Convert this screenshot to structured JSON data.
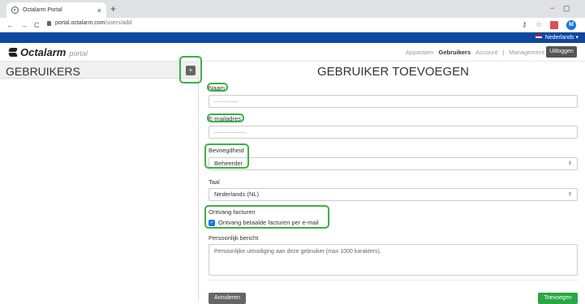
{
  "browser": {
    "tab_title": "Octalarm Portal",
    "tab_close": "×",
    "new_tab": "+",
    "url_host": "portal.octalarm.com",
    "url_path": "/users/add",
    "minimize": "−",
    "maximize": "▢",
    "avatar_letter": "M"
  },
  "langbar": {
    "language": "Nederlands ▾"
  },
  "nav": {
    "brand": "Octalarm",
    "brand_sub": "portal",
    "items": [
      "Apparaten",
      "Gebruikers",
      "Account",
      "|",
      "Management"
    ],
    "active_index": 1,
    "logout": "Uitloggen"
  },
  "left": {
    "title": "GEBRUIKERS",
    "add_button": "+"
  },
  "form": {
    "title": "GEBRUIKER TOEVOEGEN",
    "name_label": "Naam",
    "name_value": "...............",
    "email_label": "E-mailadres",
    "email_value": "....................",
    "role_label": "Bevoegdheid",
    "role_value": "Beheerder",
    "lang_label": "Taal",
    "lang_value": "Nederlands (NL)",
    "invoice_label": "Ontvang facturen",
    "invoice_check": "Ontvang betaalde facturen per e-mail",
    "message_label": "Persoonlijk bericht",
    "message_placeholder": "Persoonlijke uitnodiging aan deze gebruiker (max 1000 karakters).",
    "cancel": "Annuleren",
    "submit": "Toevoegen"
  },
  "colors": {
    "highlight": "#3cb043",
    "langbar": "#0d47a1",
    "submit": "#28a745"
  }
}
